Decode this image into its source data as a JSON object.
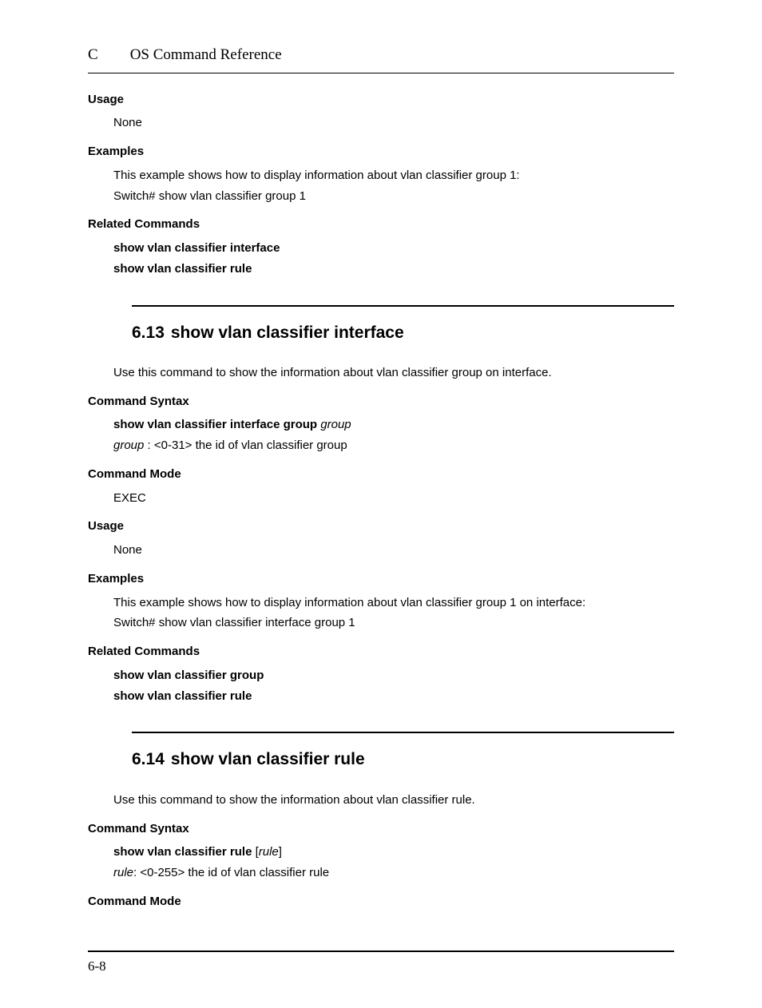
{
  "header": {
    "chapter_letter": "C",
    "doc_title": "OS Command Reference"
  },
  "top": {
    "usage_label": "Usage",
    "usage_text": "None",
    "examples_label": "Examples",
    "examples_line1": "This example shows how to display information about vlan classifier group 1:",
    "examples_line2": "Switch# show vlan classifier group 1",
    "related_label": "Related Commands",
    "related_cmd1": "show vlan classifier interface",
    "related_cmd2": "show vlan classifier rule"
  },
  "sec613": {
    "number": "6.13",
    "title": "show vlan classifier interface",
    "intro": "Use this command to show the information about vlan classifier group on interface.",
    "syntax_label": "Command Syntax",
    "syntax_line_bold": "show vlan classifier interface group",
    "syntax_line_arg": " group",
    "syntax_desc_arg": "group",
    "syntax_desc_rest": " : <0-31> the id of vlan classifier group",
    "mode_label": "Command Mode",
    "mode_value": "EXEC",
    "usage_label": "Usage",
    "usage_text": "None",
    "examples_label": "Examples",
    "examples_line1": "This example shows how to display information about vlan classifier group 1 on interface:",
    "examples_line2": "Switch# show vlan classifier interface group 1",
    "related_label": "Related Commands",
    "related_cmd1": "show vlan classifier group",
    "related_cmd2": "show vlan classifier rule"
  },
  "sec614": {
    "number": "6.14",
    "title": "show vlan classifier rule",
    "intro": "Use this command to show the information about vlan classifier rule.",
    "syntax_label": "Command Syntax",
    "syntax_line_bold": "show vlan classifier rule",
    "syntax_line_bracket_open": " [",
    "syntax_line_arg": "rule",
    "syntax_line_bracket_close": "]",
    "syntax_desc_arg": "rule",
    "syntax_desc_rest": ": <0-255> the id of vlan classifier rule",
    "mode_label": "Command Mode"
  },
  "footer": {
    "page_number": "6-8"
  }
}
